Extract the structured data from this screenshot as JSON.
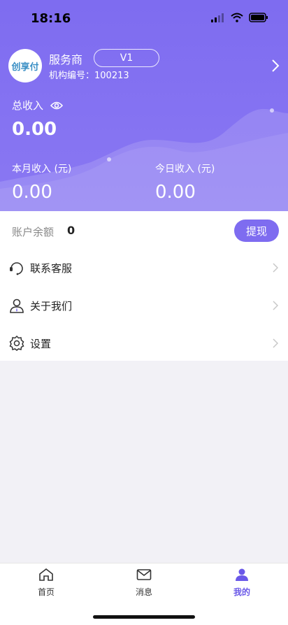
{
  "status_bar": {
    "time": "18:16"
  },
  "profile": {
    "avatar_text": "创享付",
    "provider_label": "服务商",
    "version": "V1",
    "org_label": "机构编号：",
    "org_number": "100213"
  },
  "income": {
    "total_label": "总收入",
    "total_value": "0.00",
    "month_label": "本月收入 (元)",
    "month_value": "0.00",
    "today_label": "今日收入 (元)",
    "today_value": "0.00"
  },
  "account": {
    "balance_label": "账户余额",
    "balance_value": "0",
    "withdraw_label": "提现"
  },
  "menu": [
    {
      "label": "联系客服",
      "icon": "headset-icon"
    },
    {
      "label": "关于我们",
      "icon": "user-icon"
    },
    {
      "label": "设置",
      "icon": "gear-icon"
    }
  ],
  "tabbar": [
    {
      "label": "首页",
      "icon": "home-icon"
    },
    {
      "label": "消息",
      "icon": "mail-icon"
    },
    {
      "label": "我的",
      "icon": "person-icon",
      "active": true
    }
  ],
  "colors": {
    "accent": "#7e6cf0",
    "active_tab": "#6a58e8"
  }
}
